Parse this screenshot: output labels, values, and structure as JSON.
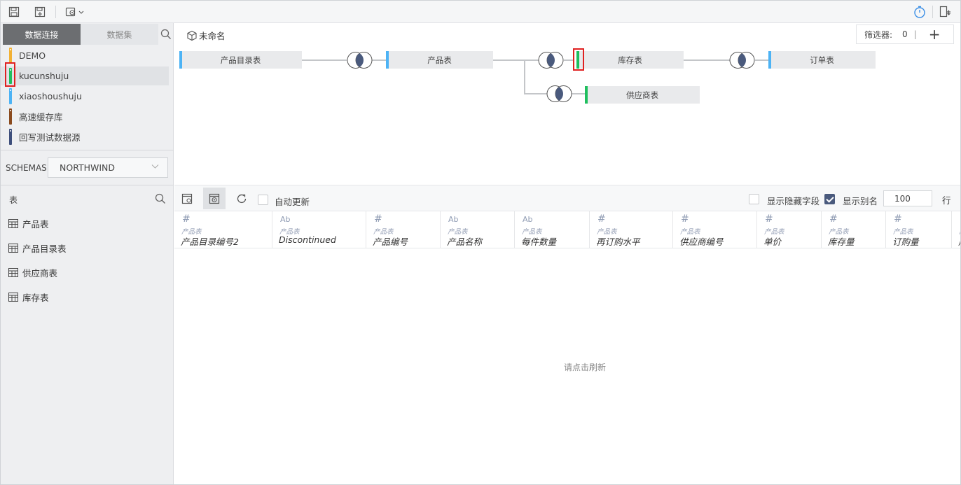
{
  "toolbar": {
    "icons": [
      "save-icon",
      "save-as-icon",
      "settings-dropdown-icon",
      "timer-icon",
      "export-icon"
    ]
  },
  "left_panel": {
    "tabs": [
      {
        "label": "数据连接",
        "active": true
      },
      {
        "label": "数据集",
        "active": false
      }
    ],
    "datasources": [
      {
        "label": "DEMO",
        "color": "#f2b134",
        "selected": false
      },
      {
        "label": "kucunshuju",
        "color": "#1fbf5e",
        "selected": true
      },
      {
        "label": "xiaoshoushuju",
        "color": "#4db3f5",
        "selected": false
      },
      {
        "label": "高速缓存库",
        "color": "#8a4a1e",
        "selected": false
      },
      {
        "label": "回写测试数据源",
        "color": "#3e4f7c",
        "selected": false
      }
    ],
    "schemas_label": "SCHEMAS",
    "schema_value": "NORTHWIND",
    "tables_header": "表",
    "tables": [
      "产品表",
      "产品目录表",
      "供应商表",
      "库存表"
    ]
  },
  "canvas": {
    "title": "未命名",
    "filter_label": "筛选器:",
    "filter_count": "0",
    "filter_sep": "|",
    "filter_add": "+",
    "nodes": [
      {
        "label": "产品目录表",
        "color": "#4db3f5"
      },
      {
        "label": "产品表",
        "color": "#4db3f5"
      },
      {
        "label": "库存表",
        "color": "#1fbf5e"
      },
      {
        "label": "订单表",
        "color": "#4db3f5"
      },
      {
        "label": "供应商表",
        "color": "#1fbf5e"
      }
    ]
  },
  "data_toolbar": {
    "auto_update_label": "自动更新",
    "auto_update_checked": false,
    "show_hidden_label": "显示隐藏字段",
    "show_hidden_checked": false,
    "show_alias_label": "显示别名",
    "show_alias_checked": true,
    "rows_value": "100",
    "rows_unit": "行"
  },
  "columns": [
    {
      "type": "#",
      "source": "产品表",
      "name": "产品目录编号2"
    },
    {
      "type": "Ab",
      "source": "产品表",
      "name": "Discontinued"
    },
    {
      "type": "#",
      "source": "产品表",
      "name": "产品编号"
    },
    {
      "type": "Ab",
      "source": "产品表",
      "name": "产品名称"
    },
    {
      "type": "Ab",
      "source": "产品表",
      "name": "每件数量"
    },
    {
      "type": "#",
      "source": "产品表",
      "name": "再订购水平"
    },
    {
      "type": "#",
      "source": "产品表",
      "name": "供应商编号"
    },
    {
      "type": "#",
      "source": "产品表",
      "name": "单价"
    },
    {
      "type": "#",
      "source": "产品表",
      "name": "库存量"
    },
    {
      "type": "#",
      "source": "产品表",
      "name": "订购量"
    },
    {
      "type": "#",
      "source": "产",
      "name": "产"
    }
  ],
  "empty_message": "请点击刷新"
}
